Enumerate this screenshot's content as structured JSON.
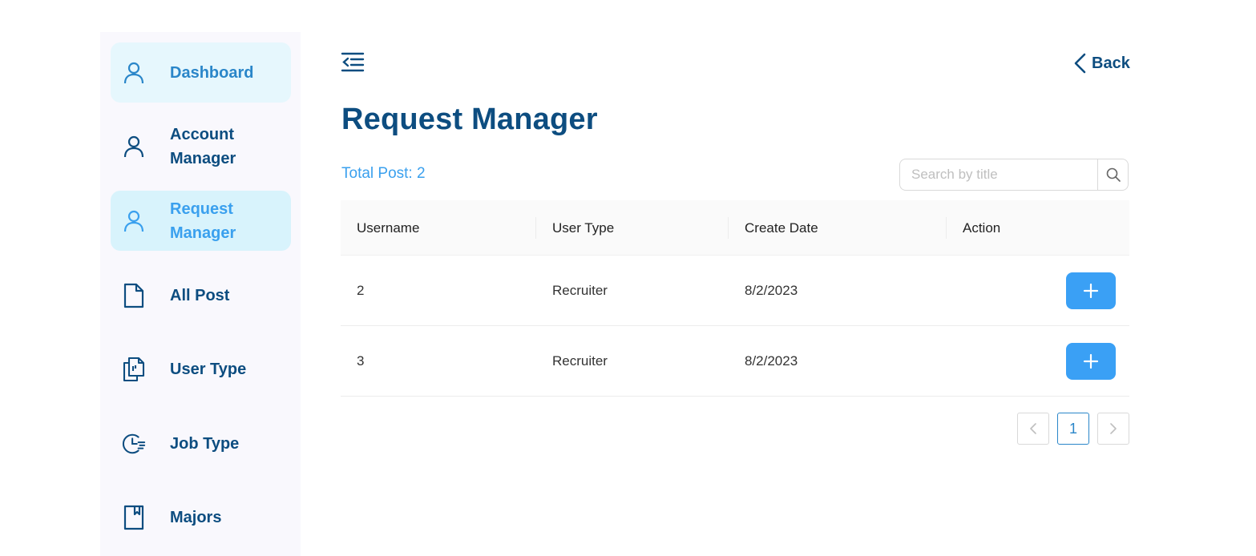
{
  "sidebar": {
    "items": [
      {
        "label": "Dashboard",
        "icon": "user-icon"
      },
      {
        "label": "Account Manager",
        "icon": "user-icon"
      },
      {
        "label": "Request Manager",
        "icon": "user-icon"
      },
      {
        "label": "All Post",
        "icon": "document-icon"
      },
      {
        "label": "User Type",
        "icon": "copy-files-icon"
      },
      {
        "label": "Job Type",
        "icon": "clock-lines-icon"
      },
      {
        "label": "Majors",
        "icon": "book-icon"
      }
    ]
  },
  "header": {
    "menu_icon": "menu-fold-icon",
    "back_label": "Back",
    "title": "Request Manager"
  },
  "summary": {
    "total_post": "Total Post: 2"
  },
  "search": {
    "placeholder": "Search by title",
    "value": ""
  },
  "table": {
    "columns": [
      "Username",
      "User Type",
      "Create Date",
      "Action"
    ],
    "rows": [
      {
        "username": "2",
        "user_type": "Recruiter",
        "create_date": "8/2/2023"
      },
      {
        "username": "3",
        "user_type": "Recruiter",
        "create_date": "8/2/2023"
      }
    ]
  },
  "pagination": {
    "current_page": "1"
  },
  "colors": {
    "primary_dark": "#0d4d80",
    "accent": "#3aa0ee",
    "button": "#3aa0f5",
    "sidebar_bg": "#f9f8fd"
  }
}
